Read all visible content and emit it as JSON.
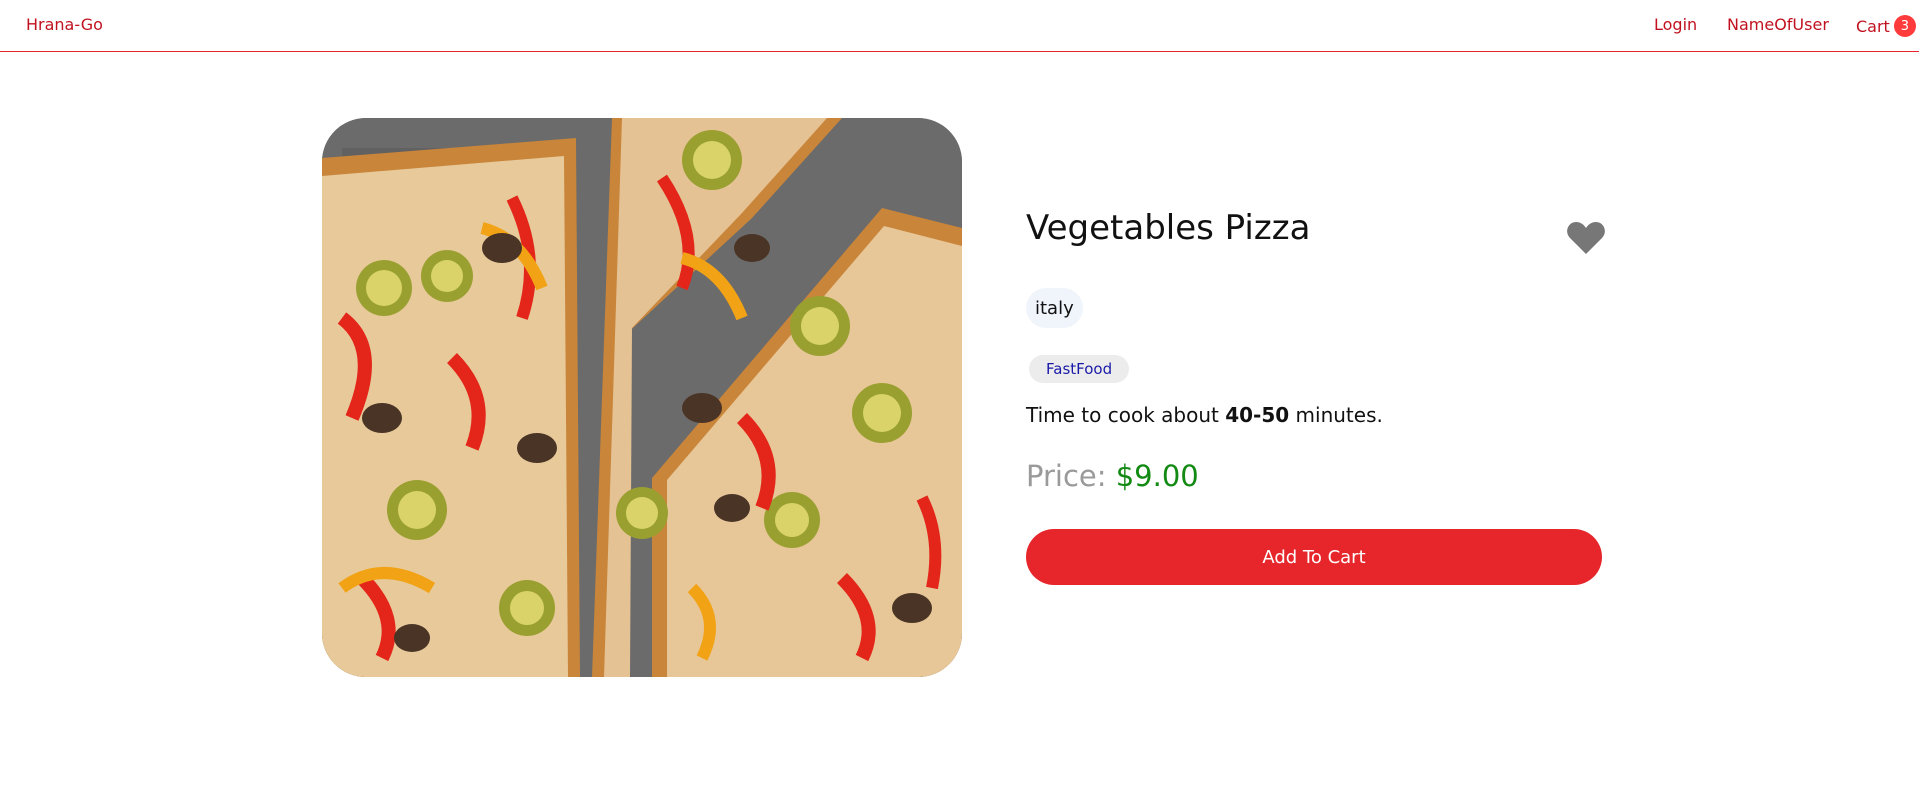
{
  "header": {
    "brand": "Hrana-Go",
    "login": "Login",
    "user": "NameOfUser",
    "cart_label": "Cart",
    "cart_count": "3"
  },
  "food": {
    "name": "Vegetables Pizza",
    "origin": "italy",
    "tag": "FastFood",
    "cook_prefix": "Time to cook about ",
    "cook_time": "40-50",
    "cook_suffix": " minutes.",
    "price_label": "Price: ",
    "price": "$9.00",
    "add_to_cart": "Add To Cart",
    "image_icon": "pizza-photo",
    "favorite_icon": "heart-icon"
  },
  "colors": {
    "accent": "#e6262b",
    "brand_text": "#c1121f",
    "price": "#138a13",
    "tag_text": "#1a1aa8",
    "favorite": "#777777"
  }
}
